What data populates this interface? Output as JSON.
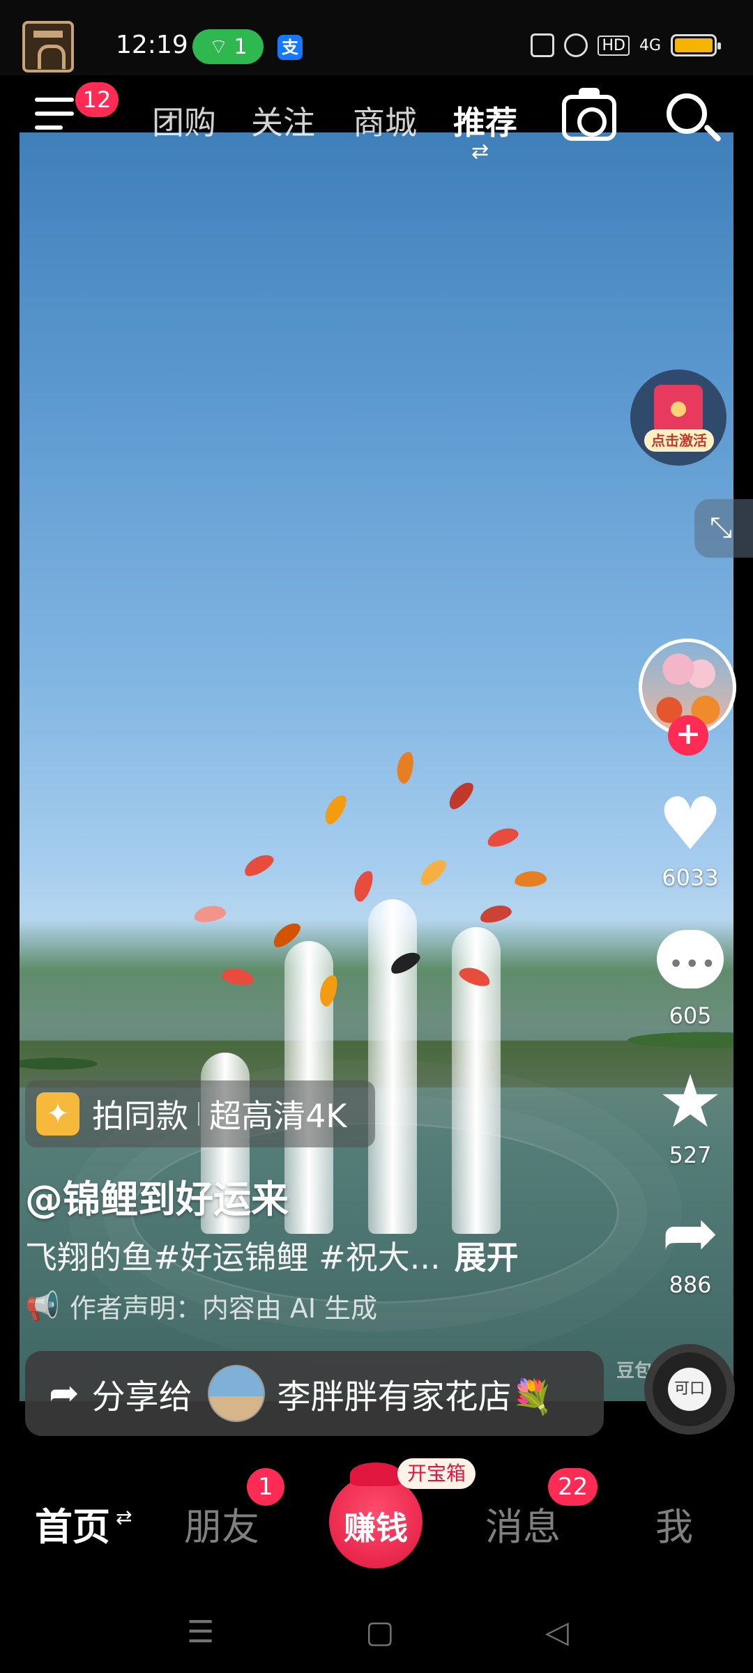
{
  "status_bar": {
    "time": "12:19",
    "wifi_badge": "1",
    "pay_icon": "支",
    "signal_label": "4G",
    "hd_label": "HD"
  },
  "top_nav": {
    "menu_badge": "12",
    "tabs": [
      {
        "label": "团购",
        "active": false
      },
      {
        "label": "关注",
        "active": false
      },
      {
        "label": "商城",
        "active": false
      },
      {
        "label": "推荐",
        "active": true
      }
    ],
    "swap_glyph": "⇄"
  },
  "right_rail": {
    "red_packet_label": "点击激活",
    "follow_glyph": "+",
    "likes": "6033",
    "comments": "605",
    "collects": "527",
    "shares": "886",
    "music_disc_text": "可口",
    "watermark": "豆包"
  },
  "caption": {
    "same_style_label": "拍同款",
    "hd_label": "超高清4K",
    "author": "@锦鲤到好运来",
    "description": "飞翔的鱼#好运锦鲤 #祝大...",
    "expand": "展开",
    "ai_notice": "作者声明：内容由 AI 生成"
  },
  "share_bar": {
    "label": "分享给",
    "friend_name": "李胖胖有家花店💐"
  },
  "bottom_nav": {
    "home": "首页",
    "home_swap": "⇄",
    "friends": "朋友",
    "friends_badge": "1",
    "earn": "赚钱",
    "treasure": "开宝箱",
    "messages": "消息",
    "messages_badge": "22",
    "me": "我"
  },
  "colors": {
    "accent": "#fe2c55",
    "wifi_pill": "#2fb84f",
    "battery": "#f4b400"
  },
  "icons": {
    "menu": "menu-icon",
    "camera": "camera-icon",
    "search": "search-icon",
    "like": "heart-icon",
    "comment": "comment-icon",
    "collect": "star-icon",
    "share": "share-arrow-icon"
  }
}
